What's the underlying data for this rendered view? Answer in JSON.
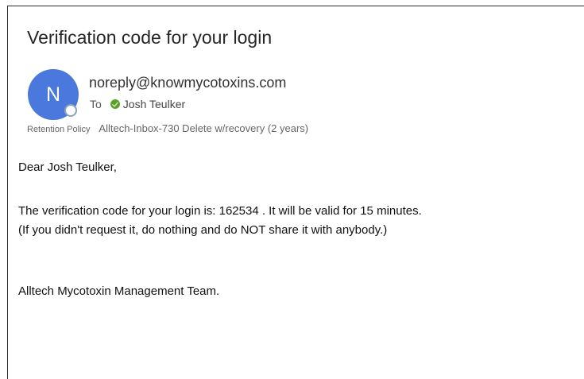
{
  "email": {
    "subject": "Verification code for your login",
    "avatar_initial": "N",
    "sender": "noreply@knowmycotoxins.com",
    "to_label": "To",
    "recipient": "Josh Teulker",
    "retention_label": "Retention Policy",
    "retention_value": "Alltech-Inbox-730 Delete w/recovery (2 years)",
    "body": {
      "greeting": "Dear Josh Teulker,",
      "line1": "The verification code for your login is: 162534 . It will be valid for 15 minutes.",
      "line2": "(If you didn't request it, do nothing and do NOT share it with anybody.)",
      "signature": "Alltech Mycotoxin Management Team."
    }
  },
  "colors": {
    "avatar": "#4a78dc",
    "presence_ring": "#8aa3b8",
    "recipient_status": "#5aa32a"
  },
  "icons": {
    "presence": "presence-status-icon",
    "recipient_status": "check-circle-icon"
  }
}
